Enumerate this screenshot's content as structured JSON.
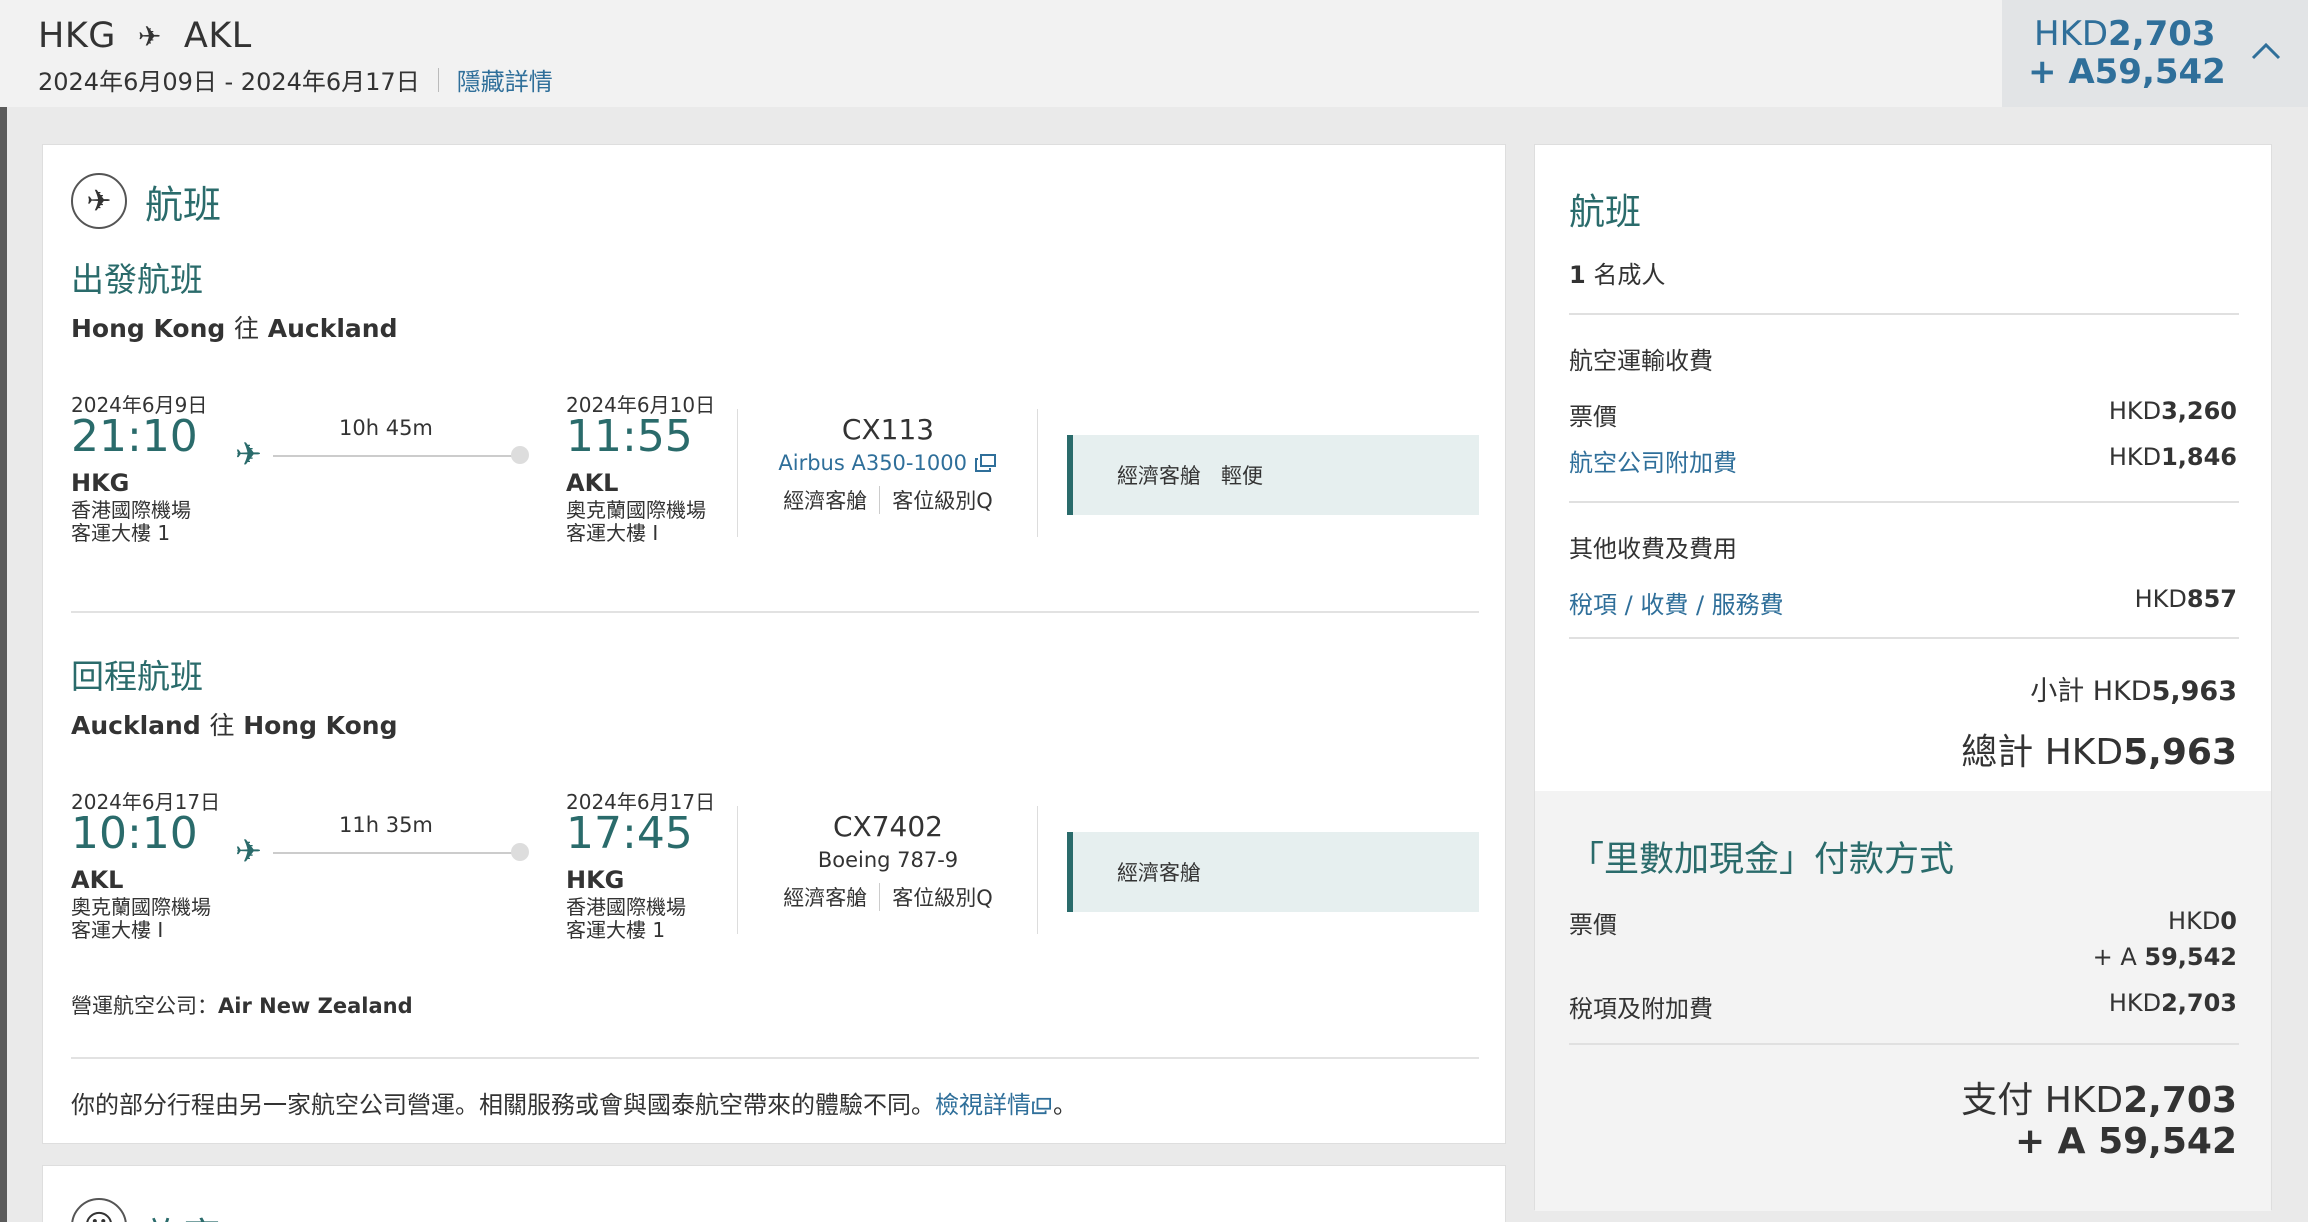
{
  "header": {
    "origin": "HKG",
    "destination": "AKL",
    "date_range": "2024年6月09日 - 2024年6月17日",
    "toggle_details": "隱藏詳情",
    "price_prefix": "HKD",
    "price_amount": "2,703",
    "miles_prefix": "+ A",
    "miles_amount": "59,542"
  },
  "flights_section": {
    "title": "航班",
    "outbound": {
      "heading": "出發航班",
      "route_from": "Hong Kong",
      "route_word": "往",
      "route_to": "Auckland",
      "dep_date": "2024年6月9日",
      "dep_time": "21:10",
      "dep_code": "HKG",
      "dep_airport": "香港國際機場",
      "dep_terminal": "客運大樓 1",
      "duration": "10h 45m",
      "arr_date": "2024年6月10日",
      "arr_time": "11:55",
      "arr_code": "AKL",
      "arr_airport": "奧克蘭國際機場",
      "arr_terminal": "客運大樓 I",
      "flight_no": "CX113",
      "aircraft": "Airbus A350-1000",
      "cabin": "經濟客艙",
      "booking_class": "客位級別Q",
      "fare_cabin": "經濟客艙",
      "fare_brand": "輕便"
    },
    "return": {
      "heading": "回程航班",
      "route_from": "Auckland",
      "route_word": "往",
      "route_to": "Hong Kong",
      "dep_date": "2024年6月17日",
      "dep_time": "10:10",
      "dep_code": "AKL",
      "dep_airport": "奧克蘭國際機場",
      "dep_terminal": "客運大樓 I",
      "duration": "11h 35m",
      "arr_date": "2024年6月17日",
      "arr_time": "17:45",
      "arr_code": "HKG",
      "arr_airport": "香港國際機場",
      "arr_terminal": "客運大樓 1",
      "flight_no": "CX7402",
      "aircraft": "Boeing 787-9",
      "cabin": "經濟客艙",
      "booking_class": "客位級別Q",
      "fare_cabin": "經濟客艙"
    },
    "operator_label": "營運航空公司：",
    "operator_name": "Air New Zealand",
    "notice_text": "你的部分行程由另一家航空公司營運。相關服務或會與國泰航空帶來的體驗不同。",
    "notice_link": "檢視詳情",
    "notice_end": "。"
  },
  "passengers_section": {
    "title": "旅客"
  },
  "summary": {
    "title": "航班",
    "pax_count": "1",
    "pax_label": "名成人",
    "air_transport_heading": "航空運輸收費",
    "fare_label": "票價",
    "fare_value_prefix": "HKD",
    "fare_value": "3,260",
    "surcharge_label": "航空公司附加費",
    "surcharge_prefix": "HKD",
    "surcharge_value": "1,846",
    "other_heading": "其他收費及費用",
    "taxes_label": "稅項 / 收費 / 服務費",
    "taxes_prefix": "HKD",
    "taxes_value": "857",
    "subtotal_label": "小計 HKD",
    "subtotal_value": "5,963",
    "total_label": "總計 HKD",
    "total_value": "5,963",
    "miles_cash_title": "「里數加現金」付款方式",
    "mc_fare_label": "票價",
    "mc_fare_hkd_prefix": "HKD",
    "mc_fare_hkd": "0",
    "mc_fare_miles_prefix": "+ A",
    "mc_fare_miles": "59,542",
    "mc_tax_label": "稅項及附加費",
    "mc_tax_prefix": "HKD",
    "mc_tax_value": "2,703",
    "pay_label": "支付 HKD",
    "pay_value": "2,703",
    "pay_miles_prefix": "+ A ",
    "pay_miles": "59,542"
  }
}
